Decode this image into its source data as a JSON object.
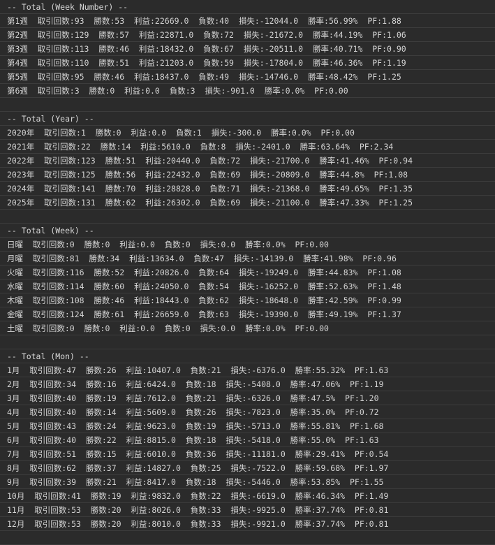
{
  "lines": [
    "-- Total (Week Number) --",
    "第1週  取引回数:93  勝数:53  利益:22669.0  負数:40  損失:-12044.0  勝率:56.99%  PF:1.88",
    "第2週  取引回数:129  勝数:57  利益:22871.0  負数:72  損失:-21672.0  勝率:44.19%  PF:1.06",
    "第3週  取引回数:113  勝数:46  利益:18432.0  負数:67  損失:-20511.0  勝率:40.71%  PF:0.90",
    "第4週  取引回数:110  勝数:51  利益:21203.0  負数:59  損失:-17804.0  勝率:46.36%  PF:1.19",
    "第5週  取引回数:95  勝数:46  利益:18437.0  負数:49  損失:-14746.0  勝率:48.42%  PF:1.25",
    "第6週  取引回数:3  勝数:0  利益:0.0  負数:3  損失:-901.0  勝率:0.0%  PF:0.00",
    "",
    "-- Total (Year) --",
    "2020年  取引回数:1  勝数:0  利益:0.0  負数:1  損失:-300.0  勝率:0.0%  PF:0.00",
    "2021年  取引回数:22  勝数:14  利益:5610.0  負数:8  損失:-2401.0  勝率:63.64%  PF:2.34",
    "2022年  取引回数:123  勝数:51  利益:20440.0  負数:72  損失:-21700.0  勝率:41.46%  PF:0.94",
    "2023年  取引回数:125  勝数:56  利益:22432.0  負数:69  損失:-20809.0  勝率:44.8%  PF:1.08",
    "2024年  取引回数:141  勝数:70  利益:28828.0  負数:71  損失:-21368.0  勝率:49.65%  PF:1.35",
    "2025年  取引回数:131  勝数:62  利益:26302.0  負数:69  損失:-21100.0  勝率:47.33%  PF:1.25",
    "",
    "-- Total (Week) --",
    "日曜  取引回数:0  勝数:0  利益:0.0  負数:0  損失:0.0  勝率:0.0%  PF:0.00",
    "月曜  取引回数:81  勝数:34  利益:13634.0  負数:47  損失:-14139.0  勝率:41.98%  PF:0.96",
    "火曜  取引回数:116  勝数:52  利益:20826.0  負数:64  損失:-19249.0  勝率:44.83%  PF:1.08",
    "水曜  取引回数:114  勝数:60  利益:24050.0  負数:54  損失:-16252.0  勝率:52.63%  PF:1.48",
    "木曜  取引回数:108  勝数:46  利益:18443.0  負数:62  損失:-18648.0  勝率:42.59%  PF:0.99",
    "金曜  取引回数:124  勝数:61  利益:26659.0  負数:63  損失:-19390.0  勝率:49.19%  PF:1.37",
    "土曜  取引回数:0  勝数:0  利益:0.0  負数:0  損失:0.0  勝率:0.0%  PF:0.00",
    "",
    "-- Total (Mon) --",
    "1月  取引回数:47  勝数:26  利益:10407.0  負数:21  損失:-6376.0  勝率:55.32%  PF:1.63",
    "2月  取引回数:34  勝数:16  利益:6424.0  負数:18  損失:-5408.0  勝率:47.06%  PF:1.19",
    "3月  取引回数:40  勝数:19  利益:7612.0  負数:21  損失:-6326.0  勝率:47.5%  PF:1.20",
    "4月  取引回数:40  勝数:14  利益:5609.0  負数:26  損失:-7823.0  勝率:35.0%  PF:0.72",
    "5月  取引回数:43  勝数:24  利益:9623.0  負数:19  損失:-5713.0  勝率:55.81%  PF:1.68",
    "6月  取引回数:40  勝数:22  利益:8815.0  負数:18  損失:-5418.0  勝率:55.0%  PF:1.63",
    "7月  取引回数:51  勝数:15  利益:6010.0  負数:36  損失:-11181.0  勝率:29.41%  PF:0.54",
    "8月  取引回数:62  勝数:37  利益:14827.0  負数:25  損失:-7522.0  勝率:59.68%  PF:1.97",
    "9月  取引回数:39  勝数:21  利益:8417.0  負数:18  損失:-5446.0  勝率:53.85%  PF:1.55",
    "10月  取引回数:41  勝数:19  利益:9832.0  負数:22  損失:-6619.0  勝率:46.34%  PF:1.49",
    "11月  取引回数:53  勝数:20  利益:8026.0  負数:33  損失:-9925.0  勝率:37.74%  PF:0.81",
    "12月  取引回数:53  勝数:20  利益:8010.0  負数:33  損失:-9921.0  勝率:37.74%  PF:0.81",
    ""
  ]
}
